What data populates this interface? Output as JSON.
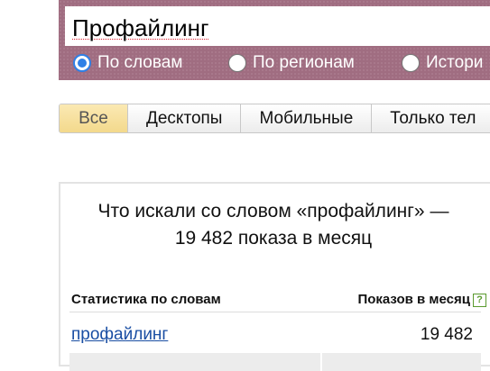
{
  "search": {
    "value": "Профайлинг",
    "modes": [
      {
        "label": "По словам",
        "checked": true
      },
      {
        "label": "По регионам",
        "checked": false
      },
      {
        "label": "Истори",
        "checked": false
      }
    ],
    "panel_color": "#a06d81"
  },
  "tabs": [
    {
      "label": "Все",
      "active": true
    },
    {
      "label": "Десктопы",
      "active": false
    },
    {
      "label": "Мобильные",
      "active": false
    },
    {
      "label": "Только тел",
      "active": false
    }
  ],
  "stats": {
    "title": "Что искали со словом «профайлинг» — 19 482 показа в месяц",
    "col_words": "Статистика по словам",
    "col_impressions": "Показов в месяц",
    "help_icon": "?",
    "rows": [
      {
        "phrase": "профайлинг",
        "count": "19 482"
      }
    ]
  }
}
